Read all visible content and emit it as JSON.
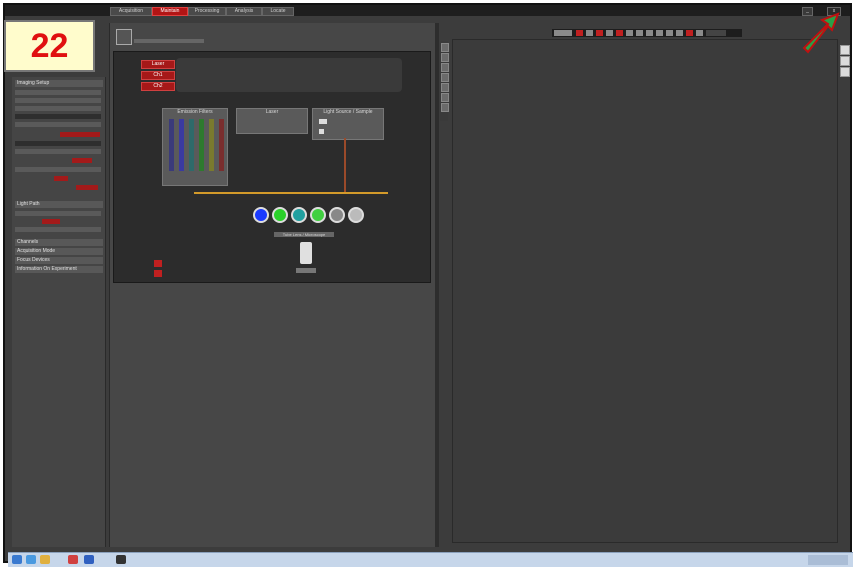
{
  "step_badge": "22",
  "tabs": [
    "Acquisition",
    "Maintain",
    "Processing",
    "Analysis",
    "Locate"
  ],
  "window_controls": [
    "_",
    "x"
  ],
  "left_panel": {
    "sections": [
      "Imaging Setup",
      "Light Path",
      "Channels",
      "Acquisition Mode",
      "Focus Devices",
      "Information On Experiment"
    ]
  },
  "light_path": {
    "beam_buttons": [
      "Laser",
      "Ch1",
      "Ch2"
    ],
    "groups": [
      "Emission Filters",
      "Laser",
      "Light Source / Sample"
    ],
    "detector_label": "Tube Lens / Microscope"
  },
  "colors": {
    "accent_red": "#b31515",
    "panel_dark": "#2c2c2c",
    "panel_mid": "#474747",
    "step_badge_text": "#e01010",
    "step_badge_bg": "#fffccc",
    "arrow_green": "#2aa048"
  },
  "icons": [
    "screen-icon",
    "objective-icon",
    "start-icon",
    "ie-icon",
    "folder-icon",
    "media-player-icon",
    "app-icon"
  ]
}
